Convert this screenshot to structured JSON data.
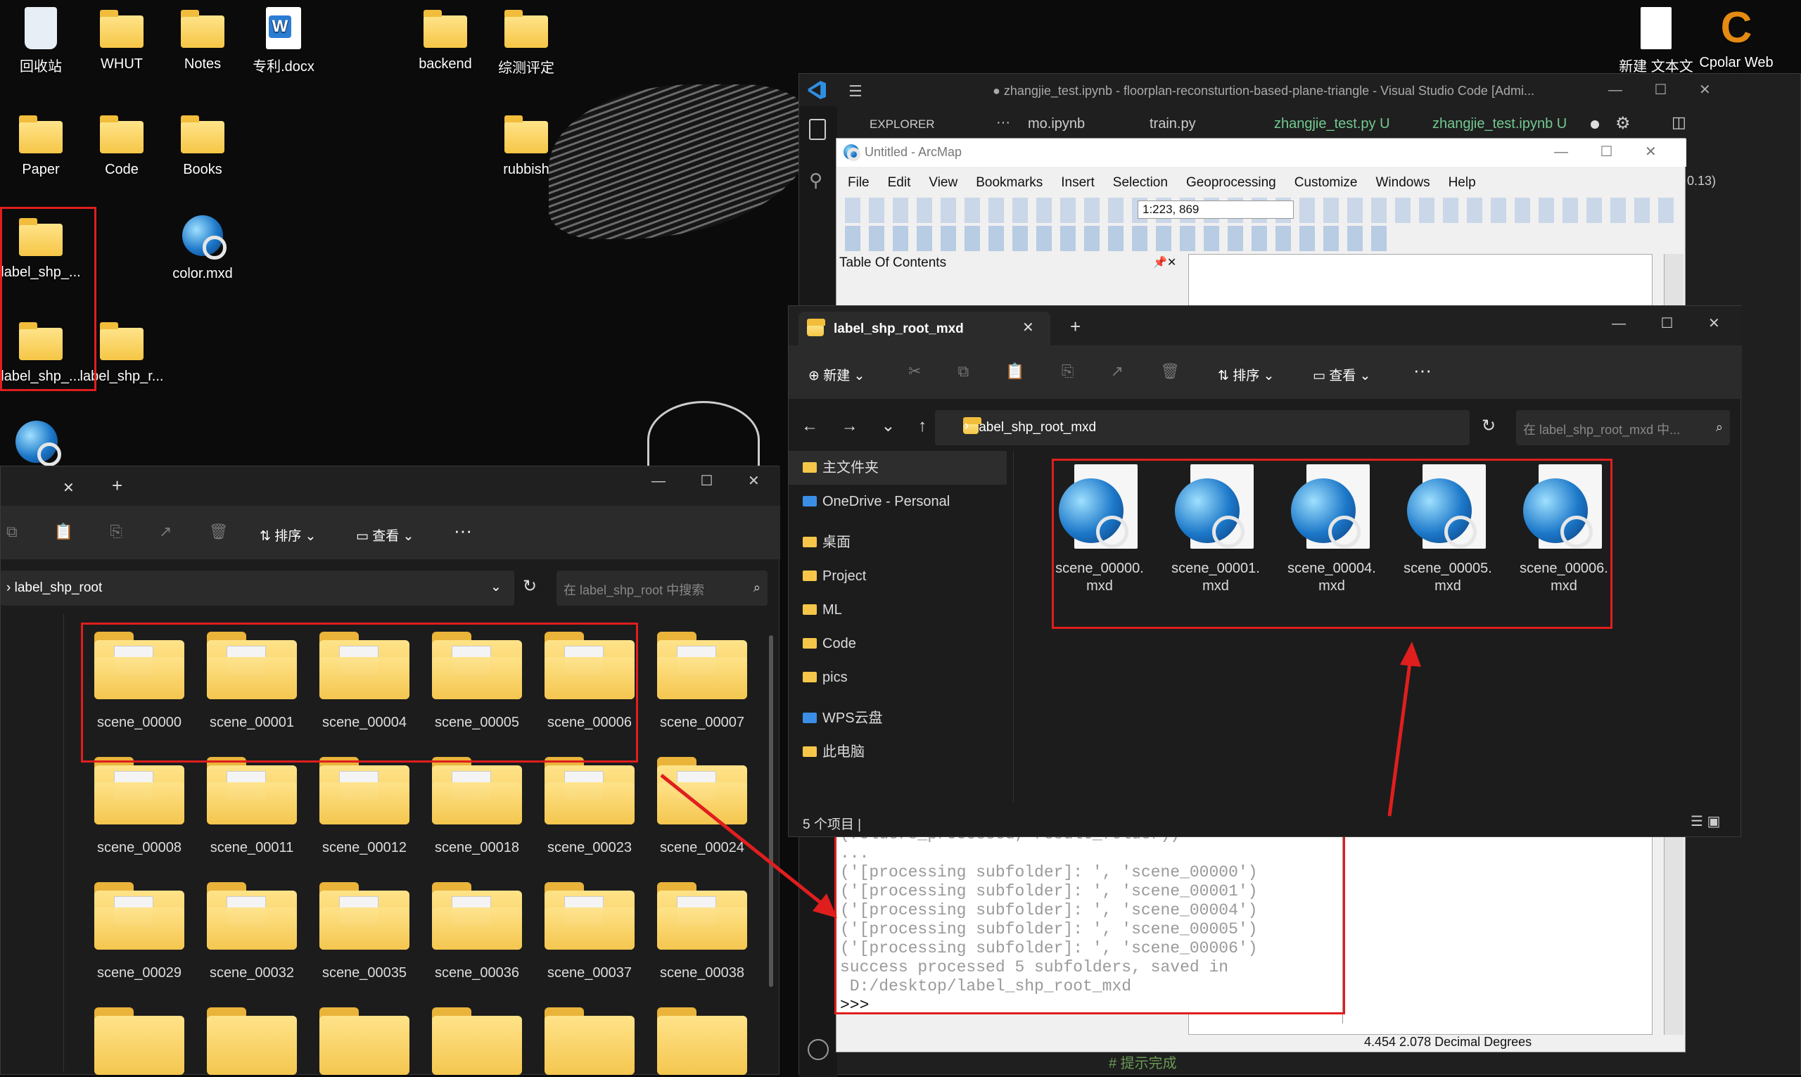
{
  "desktop": {
    "icons": [
      "回收站",
      "WHUT",
      "Notes",
      "专利.docx",
      "backend",
      "综测评定",
      "Paper",
      "Code",
      "Books",
      "rubbish",
      "label_shp_...",
      "color.mxd",
      "label_shp_...",
      "label_shp_r...",
      "新建 文本文",
      "Cpolar Web UI"
    ]
  },
  "vscode": {
    "title": "● zhangjie_test.ipynb - floorplan-reconsturtion-based-plane-triangle - Visual Studio Code [Admi...",
    "explorer": "EXPLORER",
    "tabs": [
      "mo.ipynb",
      "train.py",
      "zhangjie_test.py U",
      "zhangjie_test.ipynb U"
    ],
    "version": "0.13)",
    "comment": "# 提示完成"
  },
  "arcmap": {
    "title": "Untitled - ArcMap",
    "menu": [
      "File",
      "Edit",
      "View",
      "Bookmarks",
      "Insert",
      "Selection",
      "Geoprocessing",
      "Customize",
      "Windows",
      "Help"
    ],
    "scale": "1:223, 869",
    "toc": "Table Of Contents",
    "status": "4.454  2.078 Decimal Degrees"
  },
  "python": {
    "lines": [
      "(folders_processed, result_folder))",
      "...",
      "('[processing subfolder]: ', 'scene_00000')",
      "('[processing subfolder]: ', 'scene_00001')",
      "('[processing subfolder]: ', 'scene_00004')",
      "('[processing subfolder]: ', 'scene_00005')",
      "('[processing subfolder]: ', 'scene_00006')",
      "success processed 5 subfolders, saved in",
      " D:/desktop/label_shp_root_mxd",
      ">>> "
    ]
  },
  "explorer_right": {
    "tab": "label_shp_root_mxd",
    "new": "新建",
    "sort": "排序",
    "view": "查看",
    "breadcrumb": "label_shp_root_mxd",
    "search_placeholder": "在 label_shp_root_mxd 中...",
    "nav": [
      "主文件夹",
      "OneDrive - Personal",
      "桌面",
      "Project",
      "ML",
      "Code",
      "pics",
      "WPS云盘",
      "此电脑"
    ],
    "status": "5 个项目  |",
    "files": [
      "scene_00000.mxd",
      "scene_00001.mxd",
      "scene_00004.mxd",
      "scene_00005.mxd",
      "scene_00006.mxd"
    ]
  },
  "explorer_left": {
    "sort": "排序",
    "view": "查看",
    "breadcrumb": "label_shp_root",
    "search_placeholder": "在 label_shp_root 中搜索",
    "folders": [
      "scene_00000",
      "scene_00001",
      "scene_00004",
      "scene_00005",
      "scene_00006",
      "scene_00007",
      "scene_00008",
      "scene_00011",
      "scene_00012",
      "scene_00018",
      "scene_00023",
      "scene_00024",
      "scene_00029",
      "scene_00032",
      "scene_00035",
      "scene_00036",
      "scene_00037",
      "scene_00038"
    ]
  }
}
